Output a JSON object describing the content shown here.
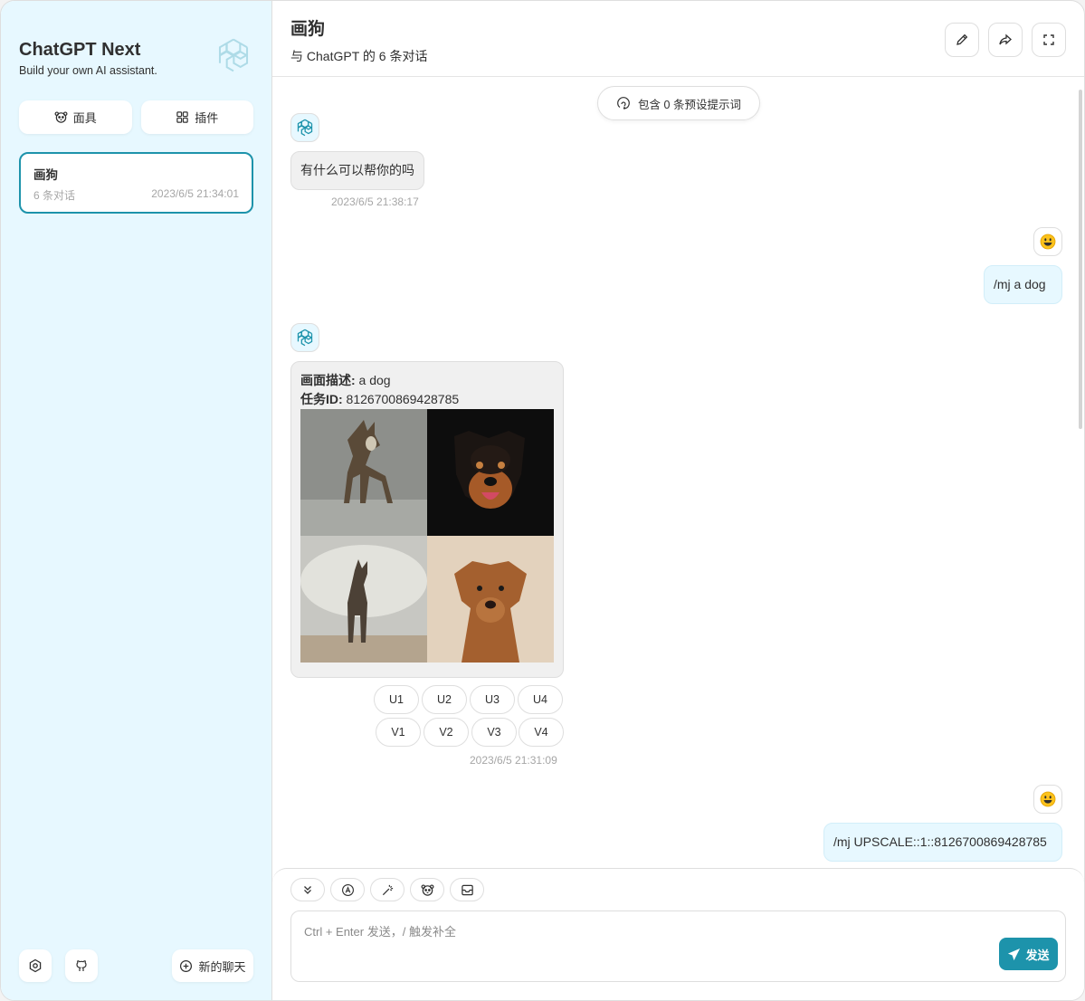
{
  "sidebar": {
    "title": "ChatGPT Next",
    "subtitle": "Build your own AI assistant.",
    "mask_button": "面具",
    "plugin_button": "插件",
    "chat_item": {
      "title": "画狗",
      "count": "6 条对话",
      "date": "2023/6/5 21:34:01"
    },
    "new_chat": "新的聊天"
  },
  "header": {
    "title": "画狗",
    "subtitle": "与 ChatGPT 的 6 条对话"
  },
  "chat": {
    "context_pill": "包含 0 条预设提示词",
    "msg1": {
      "text": "有什么可以帮你的吗",
      "date": "2023/6/5 21:38:17"
    },
    "msg2": {
      "text": "/mj a dog"
    },
    "msg3": {
      "desc_label": "画面描述:",
      "desc_value": " a dog",
      "task_label": "任务ID:",
      "task_value": " 8126700869428785",
      "date": "2023/6/5 21:31:09",
      "upscale": [
        "U1",
        "U2",
        "U3",
        "U4"
      ],
      "variation": [
        "V1",
        "V2",
        "V3",
        "V4"
      ]
    },
    "msg4": {
      "text": "/mj UPSCALE::1::8126700869428785"
    }
  },
  "input": {
    "placeholder": "Ctrl + Enter 发送，/ 触发补全",
    "send": "发送"
  },
  "colors": {
    "accent": "#1d93ab",
    "sidebar_bg": "#e7f8ff",
    "bot_bubble": "#f0f0f0",
    "user_bubble": "#e7f8ff"
  }
}
